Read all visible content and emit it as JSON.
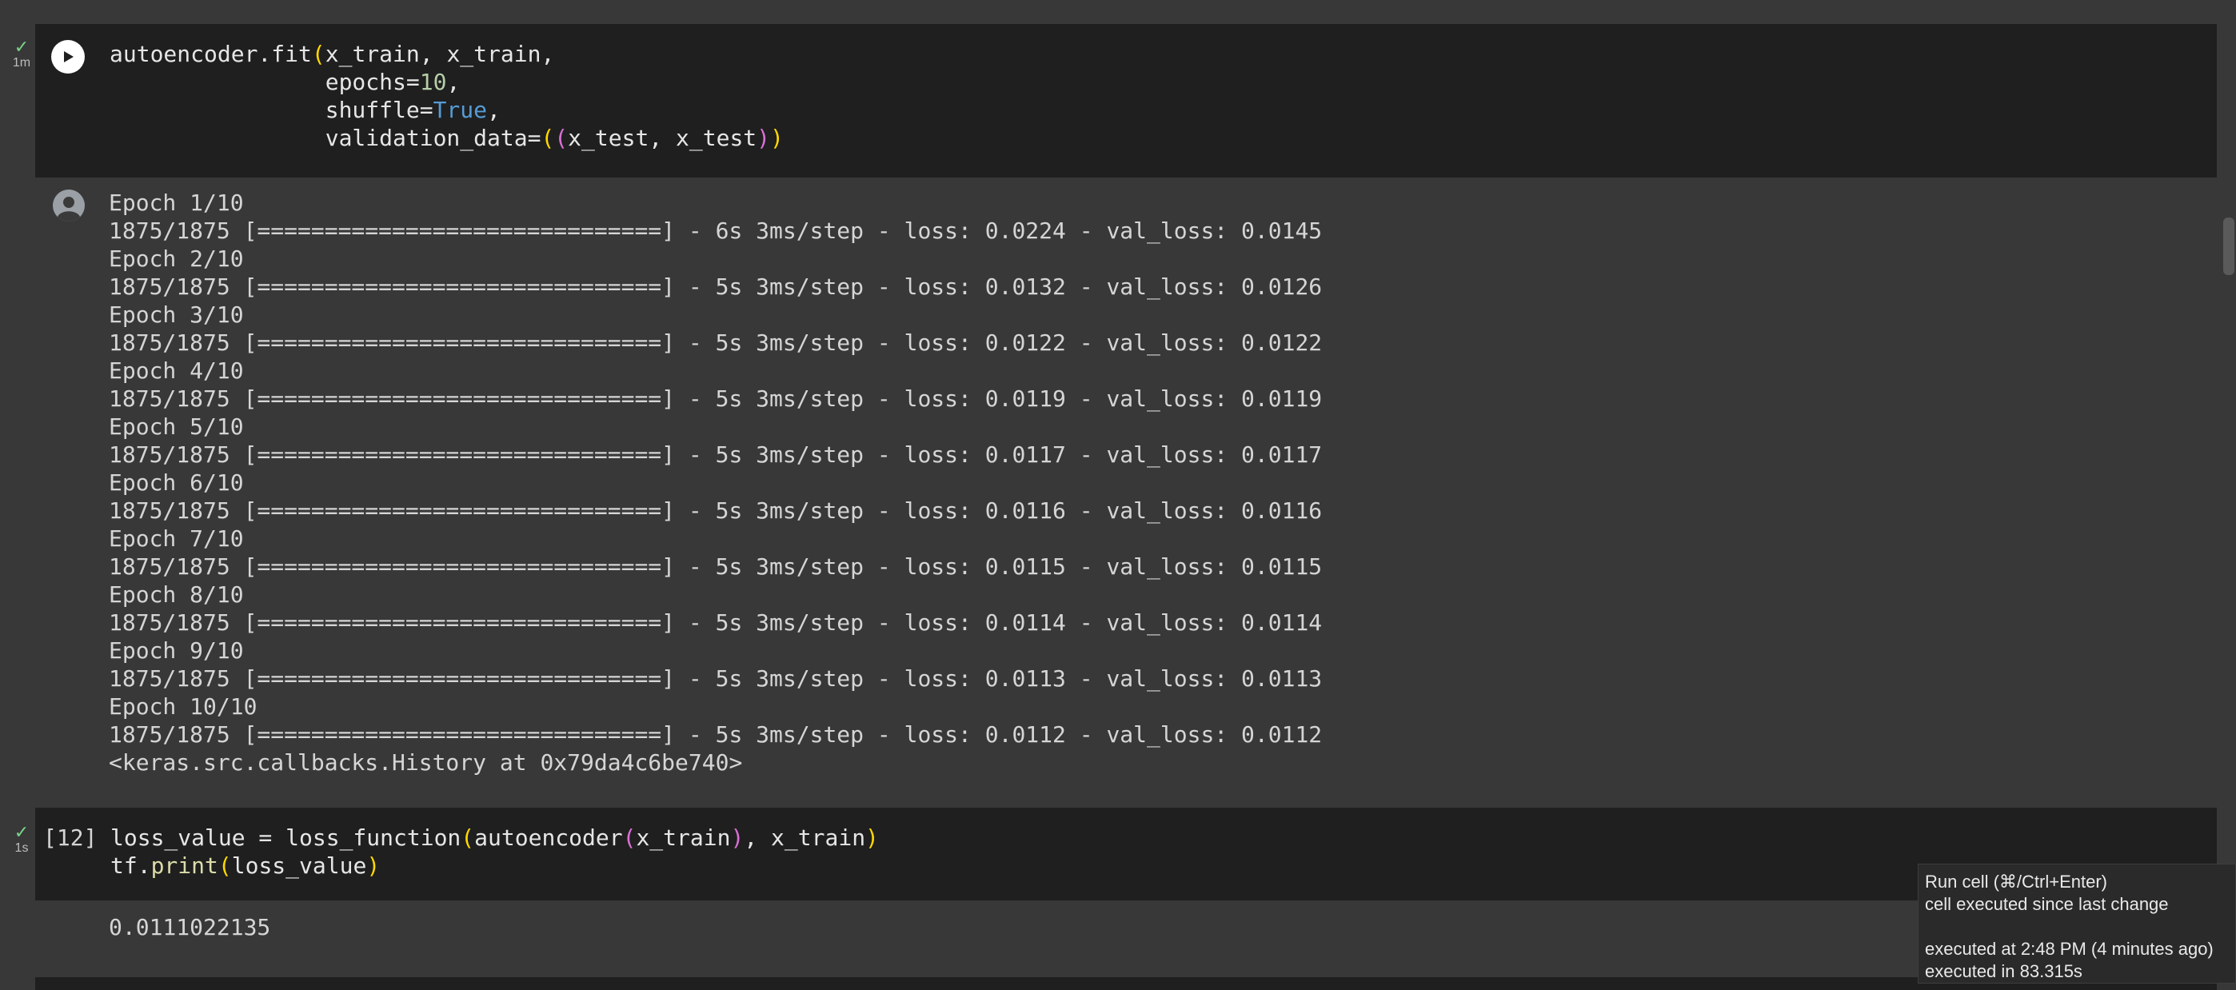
{
  "cells": [
    {
      "status": {
        "check": "✓",
        "time": "1m"
      },
      "code_lines": [
        [
          {
            "t": "autoencoder.fit"
          },
          {
            "t": "(",
            "c": "p1"
          },
          {
            "t": "x_train, x_train,"
          }
        ],
        [
          {
            "t": "                epochs="
          },
          {
            "t": "10",
            "c": "num"
          },
          {
            "t": ","
          }
        ],
        [
          {
            "t": "                shuffle="
          },
          {
            "t": "True",
            "c": "kw"
          },
          {
            "t": ","
          }
        ],
        [
          {
            "t": "                validation_data="
          },
          {
            "t": "(",
            "c": "p1"
          },
          {
            "t": "(",
            "c": "p2"
          },
          {
            "t": "x_test, x_test"
          },
          {
            "t": ")",
            "c": "p2"
          },
          {
            "t": ")",
            "c": "p1"
          }
        ]
      ],
      "output_lines": [
        "Epoch 1/10",
        "1875/1875 [==============================] - 6s 3ms/step - loss: 0.0224 - val_loss: 0.0145",
        "Epoch 2/10",
        "1875/1875 [==============================] - 5s 3ms/step - loss: 0.0132 - val_loss: 0.0126",
        "Epoch 3/10",
        "1875/1875 [==============================] - 5s 3ms/step - loss: 0.0122 - val_loss: 0.0122",
        "Epoch 4/10",
        "1875/1875 [==============================] - 5s 3ms/step - loss: 0.0119 - val_loss: 0.0119",
        "Epoch 5/10",
        "1875/1875 [==============================] - 5s 3ms/step - loss: 0.0117 - val_loss: 0.0117",
        "Epoch 6/10",
        "1875/1875 [==============================] - 5s 3ms/step - loss: 0.0116 - val_loss: 0.0116",
        "Epoch 7/10",
        "1875/1875 [==============================] - 5s 3ms/step - loss: 0.0115 - val_loss: 0.0115",
        "Epoch 8/10",
        "1875/1875 [==============================] - 5s 3ms/step - loss: 0.0114 - val_loss: 0.0114",
        "Epoch 9/10",
        "1875/1875 [==============================] - 5s 3ms/step - loss: 0.0113 - val_loss: 0.0113",
        "Epoch 10/10",
        "1875/1875 [==============================] - 5s 3ms/step - loss: 0.0112 - val_loss: 0.0112",
        "<keras.src.callbacks.History at 0x79da4c6be740>"
      ]
    },
    {
      "status": {
        "check": "✓",
        "time": "1s"
      },
      "exec_count": "[12]",
      "code_lines": [
        [
          {
            "t": "loss_value = loss_function"
          },
          {
            "t": "(",
            "c": "p1"
          },
          {
            "t": "autoencoder"
          },
          {
            "t": "(",
            "c": "p2"
          },
          {
            "t": "x_train"
          },
          {
            "t": ")",
            "c": "p2"
          },
          {
            "t": ", x_train"
          },
          {
            "t": ")",
            "c": "p1"
          }
        ],
        [
          {
            "t": "tf."
          },
          {
            "t": "print",
            "c": "fn"
          },
          {
            "t": "(",
            "c": "p1"
          },
          {
            "t": "loss_value"
          },
          {
            "t": ")",
            "c": "p1"
          }
        ]
      ],
      "output_lines": [
        "0.0111022135"
      ]
    }
  ],
  "tooltip": {
    "line1": "Run cell (⌘/Ctrl+Enter)",
    "line2": "cell executed since last change",
    "line3": "executed at 2:48 PM (4 minutes ago)",
    "line4": "executed in 83.315s"
  },
  "icons": {
    "run": "play-icon",
    "output": "user-avatar-icon",
    "status": "check-icon"
  }
}
